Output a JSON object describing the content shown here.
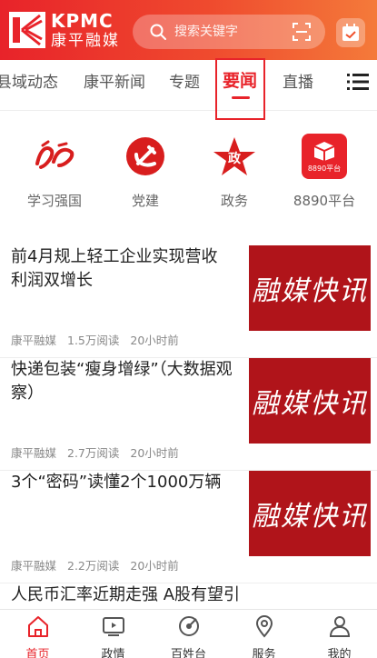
{
  "header": {
    "logo_en": "KPMC",
    "logo_cn": "康平融媒",
    "search_placeholder": "搜索关键字"
  },
  "tabs": [
    {
      "label": "县域动态"
    },
    {
      "label": "康平新闻"
    },
    {
      "label": "专题"
    },
    {
      "label": "要闻",
      "active": true
    },
    {
      "label": "直播"
    }
  ],
  "quick_links": [
    {
      "label": "学习强国",
      "icon": "xuexi-icon"
    },
    {
      "label": "党建",
      "icon": "party-emblem-icon"
    },
    {
      "label": "政务",
      "icon": "government-star-icon"
    },
    {
      "label": "8890平台",
      "icon": "platform-box-icon",
      "badge": "8890平台"
    }
  ],
  "news": [
    {
      "title": "前4月规上轻工企业实现营收利润双增长",
      "source": "康平融媒",
      "reads": "1.5万阅读",
      "time": "20小时前",
      "thumb": "融媒快讯"
    },
    {
      "title": "快递包装“瘦身增绿”（大数据观察）",
      "source": "康平融媒",
      "reads": "2.7万阅读",
      "time": "20小时前",
      "thumb": "融媒快讯"
    },
    {
      "title": "3个“密码”读懂2个1000万辆",
      "source": "康平融媒",
      "reads": "2.2万阅读",
      "time": "20小时前",
      "thumb": "融媒快讯"
    },
    {
      "title": "人民币汇率近期走强 A股有望引来更多外资“活水”",
      "source": "",
      "reads": "",
      "time": "",
      "thumb": ""
    }
  ],
  "bottom_nav": [
    {
      "label": "首页",
      "active": true
    },
    {
      "label": "政情"
    },
    {
      "label": "百姓台"
    },
    {
      "label": "服务"
    },
    {
      "label": "我的"
    }
  ],
  "colors": {
    "accent": "#e8232a",
    "thumb_bg": "#b0141a"
  }
}
